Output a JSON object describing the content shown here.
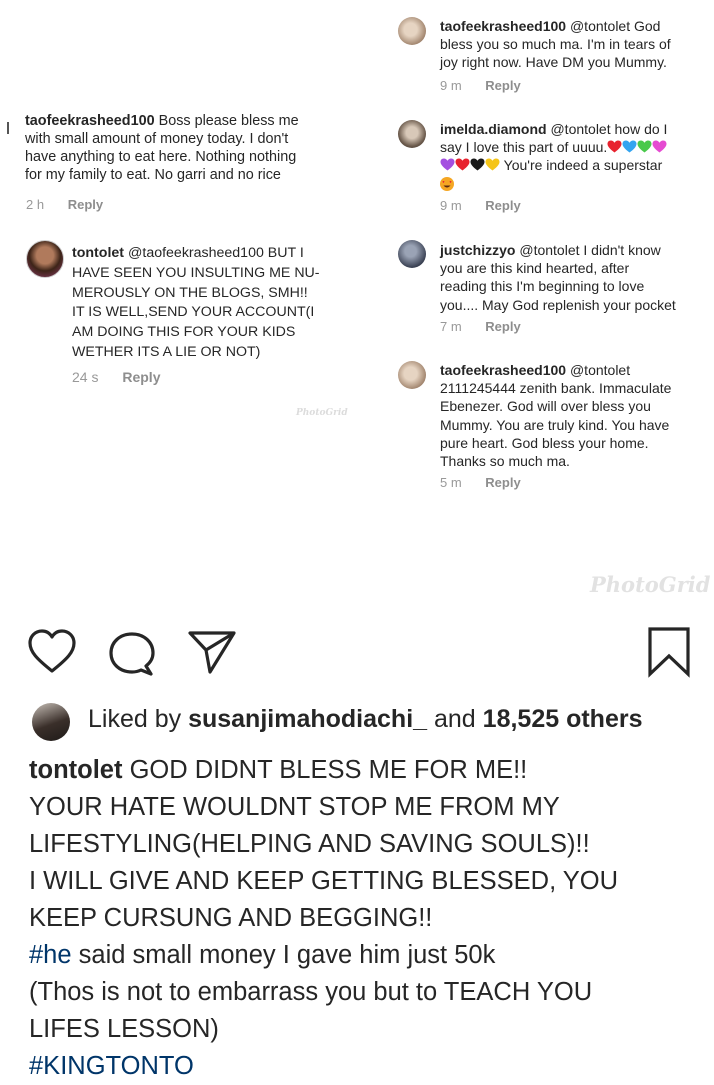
{
  "collage": {
    "watermark_small": "PhotoGrid",
    "watermark_large": "PhotoGrid",
    "left_comments": [
      {
        "username": "taofeekrasheed100",
        "lines": [
          "Boss please bless me",
          "with small amount of money today. I don't",
          "have anything to eat here. Nothing nothing",
          "for my family to eat. No garri and no rice"
        ],
        "time": "2 h",
        "reply": "Reply"
      },
      {
        "username": "tontolet",
        "lines": [
          "@taofeekrasheed100 BUT I",
          "HAVE SEEN YOU INSULTING ME NU-",
          "MEROUSLY ON THE BLOGS, SMH!!",
          "IT IS WELL,SEND YOUR ACCOUNT(I",
          "AM DOING THIS FOR YOUR KIDS",
          "WETHER ITS A LIE OR NOT)"
        ],
        "time": "24 s",
        "reply": "Reply"
      }
    ],
    "right_comments": [
      {
        "username": "taofeekrasheed100",
        "lines": [
          "@tontolet God",
          "bless you so much ma. I'm in tears of",
          "joy right now. Have DM you Mummy."
        ],
        "time": "9 m",
        "reply": "Reply"
      },
      {
        "username": "imelda.diamond",
        "lines": [
          "@tontolet how do I",
          "say I love this part of uuuu.",
          "You're indeed a superstar",
          ""
        ],
        "emoji_row1": [
          "#e8232f",
          "#33a4f0",
          "#49c94b",
          "#e54bd1"
        ],
        "emoji_row2": [
          "#a44fe0",
          "#e8232f",
          "#1a1a1a",
          "#f5c518"
        ],
        "emoji_row3": "#f5a623",
        "time": "9 m",
        "reply": "Reply"
      },
      {
        "username": "justchizzyo",
        "lines": [
          "@tontolet I didn't know",
          "you are this kind hearted, after",
          "reading this I'm beginning to love",
          "you.... May God replenish your pocket"
        ],
        "time": "7 m",
        "reply": "Reply"
      },
      {
        "username": "taofeekrasheed100",
        "lines": [
          "@tontolet",
          "2111245444 zenith bank. Immaculate",
          "Ebenezer. God will over bless you",
          "Mummy. You are truly kind. You have",
          "pure heart. God bless your home.",
          "Thanks so much ma."
        ],
        "time": "5 m",
        "reply": "Reply"
      }
    ]
  },
  "actions": {
    "like_icon": "heart-outline-icon",
    "comment_icon": "comment-bubble-icon",
    "share_icon": "paper-plane-icon",
    "save_icon": "bookmark-outline-icon"
  },
  "likes": {
    "prefix": "Liked by",
    "user": "susanjimahodiachi_",
    "middle": "and",
    "others": "18,525 others"
  },
  "caption": {
    "username": "tontolet",
    "line1": "GOD DIDNT BLESS ME FOR ME!!",
    "line2": "YOUR HATE WOULDNT STOP ME FROM MY",
    "line3": "LIFESTYLING(HELPING AND SAVING SOULS)!!",
    "line4": "I WILL GIVE AND KEEP GETTING BLESSED, YOU",
    "line5": "KEEP CURSUNG AND BEGGING!!",
    "hashtag1": "#he",
    "line6_rest": "said small money I gave him just 50k",
    "line7": "(Thos is not to embarrass you but to TEACH YOU",
    "line8": "LIFES LESSON)",
    "hashtag2": "#KINGTONTO"
  },
  "colors": {
    "text": "#262626",
    "meta": "#999999",
    "hashtag": "#003569"
  }
}
